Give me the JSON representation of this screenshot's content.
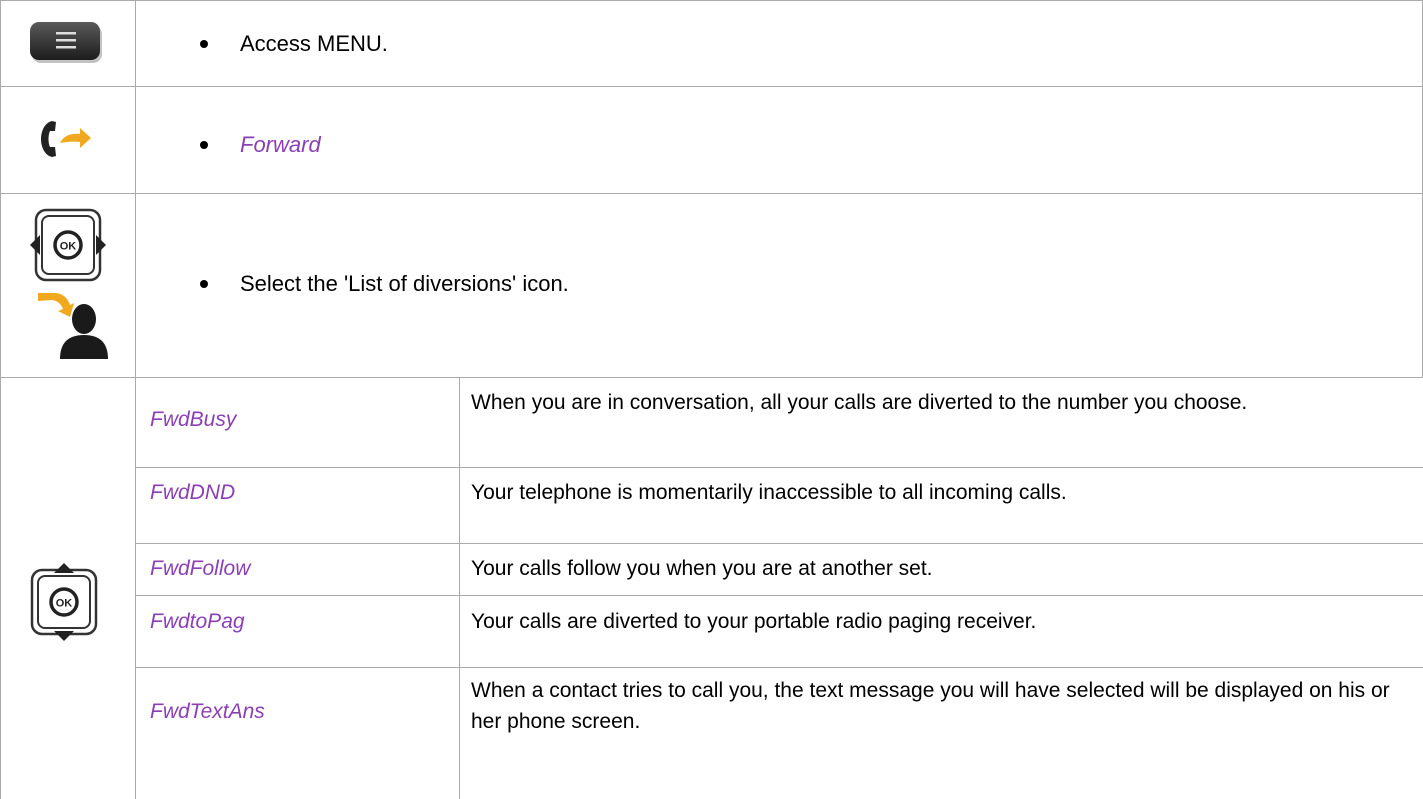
{
  "rows": {
    "menu": {
      "text": "Access MENU.",
      "icon": "menu-button-icon"
    },
    "forward": {
      "text": "Forward",
      "icon": "phone-forward-icon"
    },
    "select": {
      "text": "Select the 'List of diversions' icon.",
      "icons": [
        "ok-left-right-navigator-icon",
        "diversion-user-icon"
      ]
    },
    "options_icon": "ok-up-down-navigator-icon",
    "options": [
      {
        "name": "FwdBusy",
        "desc": "When you are in conversation, all your calls are diverted to the number you choose."
      },
      {
        "name": "FwdDND",
        "desc": "Your telephone is momentarily inaccessible to all incoming calls."
      },
      {
        "name": "FwdFollow",
        "desc": "Your calls follow you when you are at another set."
      },
      {
        "name": "FwdtoPag",
        "desc": "Your calls are diverted to your portable radio paging receiver."
      },
      {
        "name": "FwdTextAns",
        "desc": "When a contact tries to call you, the text message you will have selected will be displayed on his or her phone screen."
      }
    ]
  },
  "colors": {
    "accent_purple": "#8a3fb5",
    "grid": "#aaaaaa",
    "arrow_orange": "#f0a81e"
  }
}
